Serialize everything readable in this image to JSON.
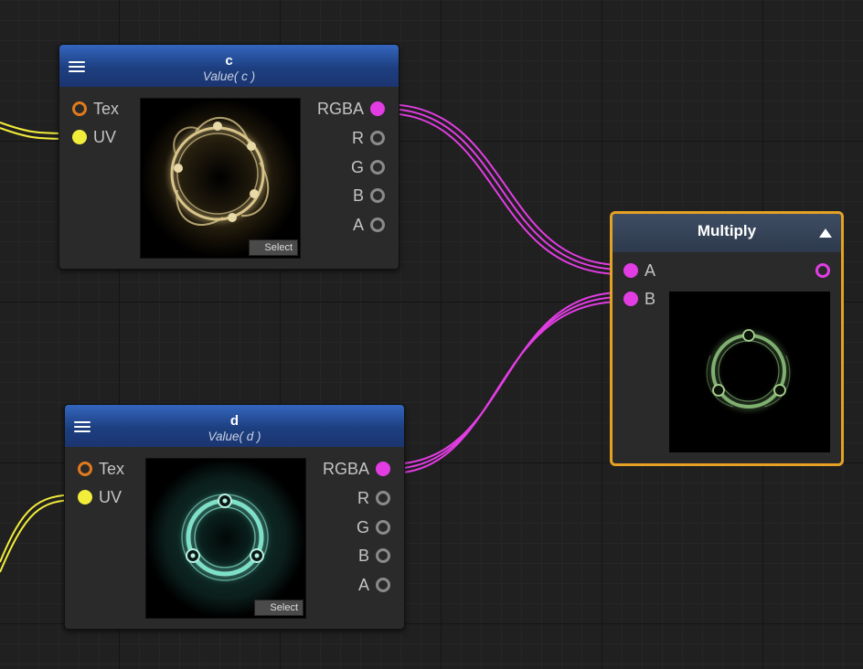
{
  "node_c": {
    "title": "c",
    "subtitle": "Value( c )",
    "select_label": "Select"
  },
  "node_d": {
    "title": "d",
    "subtitle": "Value( d )",
    "select_label": "Select"
  },
  "ports": {
    "tex": "Tex",
    "uv": "UV",
    "rgba": "RGBA",
    "r": "R",
    "g": "G",
    "b": "B",
    "a": "A"
  },
  "multiply": {
    "title": "Multiply",
    "input_a": "A",
    "input_b": "B"
  },
  "colors": {
    "selected_outline": "#e5a123",
    "header_blue": "#1d3f80",
    "wire_rgba": "#e23de3",
    "wire_uv": "#f2ec3a",
    "tex_port": "#e07a1c",
    "texture_c": "#d9c58a",
    "texture_d": "#7fe0c8",
    "texture_result": "#7fb070"
  },
  "icons": {
    "menu": "hamburger-menu-icon",
    "collapse": "triangle-up-icon"
  }
}
